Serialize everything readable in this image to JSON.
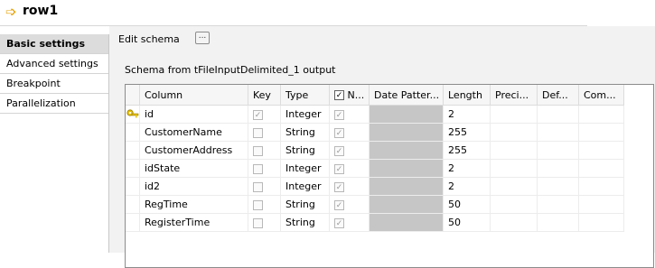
{
  "header": {
    "title": "row1"
  },
  "sidebar": {
    "items": [
      {
        "label": "Basic settings",
        "active": true
      },
      {
        "label": "Advanced settings",
        "active": false
      },
      {
        "label": "Breakpoint",
        "active": false
      },
      {
        "label": "Parallelization",
        "active": false
      }
    ]
  },
  "content": {
    "edit_schema_label": "Edit schema",
    "edit_schema_button": "...",
    "schema_title": "Schema from tFileInputDelimited_1 output"
  },
  "table": {
    "columns": [
      "Column",
      "Key",
      "Type",
      "N...",
      "Date Patter...",
      "Length",
      "Preci...",
      "Def...",
      "Com..."
    ],
    "rows": [
      {
        "column": "id",
        "key": true,
        "type": "Integer",
        "nullable": true,
        "length": "2",
        "is_key_icon": true
      },
      {
        "column": "CustomerName",
        "key": false,
        "type": "String",
        "nullable": true,
        "length": "255",
        "is_key_icon": false
      },
      {
        "column": "CustomerAddress",
        "key": false,
        "type": "String",
        "nullable": true,
        "length": "255",
        "is_key_icon": false
      },
      {
        "column": "idState",
        "key": false,
        "type": "Integer",
        "nullable": true,
        "length": "2",
        "is_key_icon": false
      },
      {
        "column": "id2",
        "key": false,
        "type": "Integer",
        "nullable": true,
        "length": "2",
        "is_key_icon": false
      },
      {
        "column": "RegTime",
        "key": false,
        "type": "String",
        "nullable": true,
        "length": "50",
        "is_key_icon": false
      },
      {
        "column": "RegisterTime",
        "key": false,
        "type": "String",
        "nullable": true,
        "length": "50",
        "is_key_icon": false
      }
    ]
  },
  "icons": {
    "title": "arrow-right-icon",
    "key": "key-icon",
    "edit": "ellipsis-icon"
  }
}
